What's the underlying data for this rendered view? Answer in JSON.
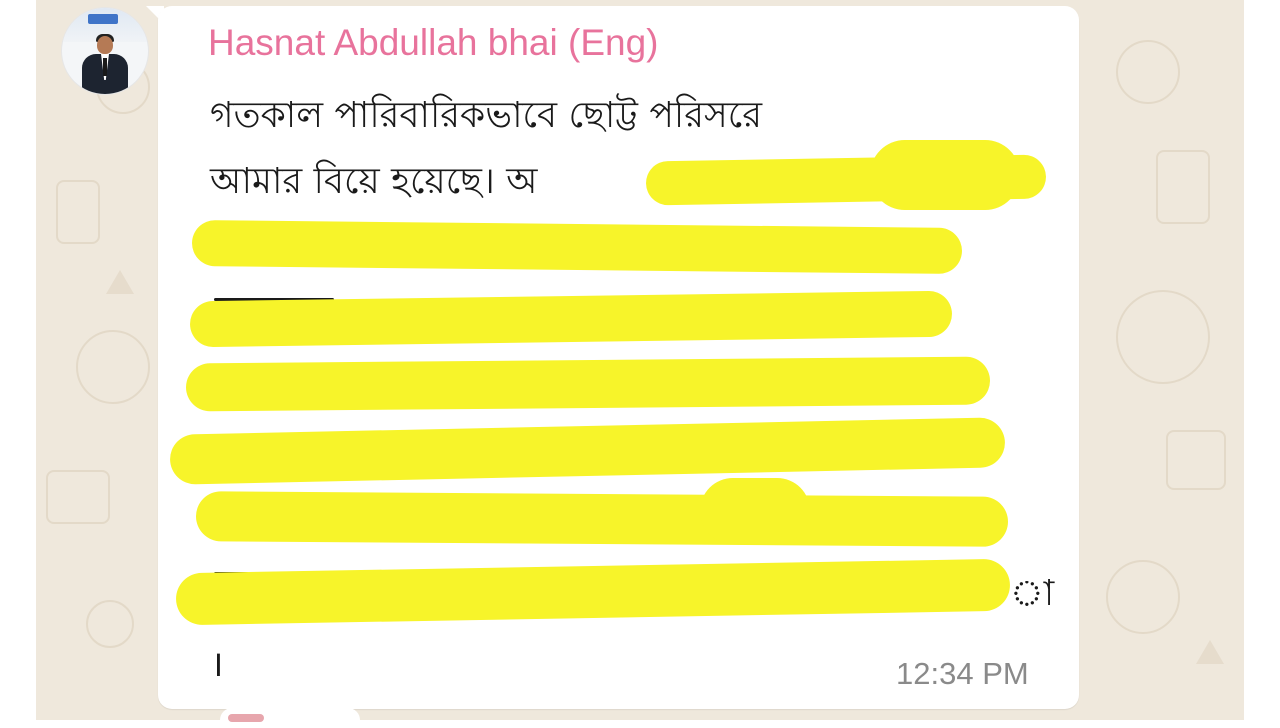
{
  "message": {
    "sender_name": "Hasnat Abdullah bhai (Eng)",
    "text_lines": [
      "গতকাল পারিবারিকভাবে ছোট্ট পরিসরে",
      "আমার বিয়ে হয়েছে। অ"
    ],
    "trailing_text": "।",
    "tail_fragment": "া",
    "time": "12:34 PM"
  },
  "avatar": {
    "icon": "profile-photo-man-in-suit"
  },
  "colors": {
    "sender_name": "#e8739c",
    "redaction_highlight": "#f7f42a",
    "chat_background": "#efe8dc",
    "bubble": "#ffffff",
    "timestamp": "#8a8a8a"
  }
}
